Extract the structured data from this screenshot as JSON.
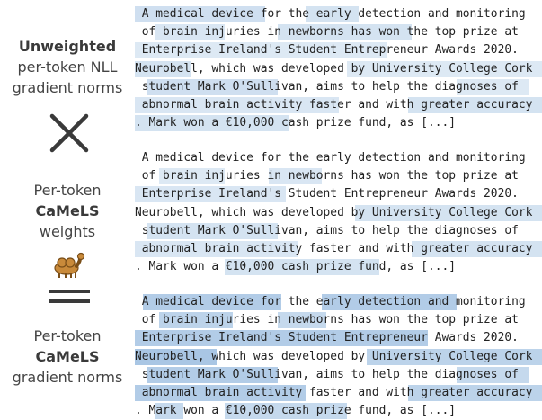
{
  "left_labels": [
    {
      "bold_line": "Unweighted",
      "lines": [
        "per-token NLL",
        "gradient norms"
      ]
    },
    {
      "lines": [
        "Per-token"
      ],
      "bold_line": "CaMeLS",
      "after": [
        "weights"
      ]
    },
    {
      "lines": [
        "Per-token"
      ],
      "bold_line": "CaMeLS",
      "after": [
        "gradient norms"
      ]
    }
  ],
  "operators": [
    "times-icon",
    "equals-icon"
  ],
  "colors": {
    "hl_light": "#dbe8f5",
    "hl_mid": "#b7d0ea",
    "hl_strong": "#8fb1d8",
    "text": "#222222"
  },
  "panels": [
    {
      "id": "unweighted",
      "lines": [
        [
          [
            " A medical device for the early detection and monitoring",
            0
          ]
        ],
        [
          [
            " of brain injuries in newborns has won the top prize at",
            0
          ]
        ],
        [
          [
            " Enterprise Ireland's Student Entrepreneur Awards 2020.",
            0
          ]
        ],
        [
          [
            "Neurobell, which was developed by University College Cork",
            0
          ]
        ],
        [
          [
            " student Mark O'Sullivan, aims to help the diagnoses of",
            0
          ]
        ],
        [
          [
            " abnormal brain activity faster and with greater accuracy",
            0
          ]
        ],
        [
          [
            ". Mark won a €10,000 cash prize fund, as [...]",
            0
          ]
        ]
      ]
    },
    {
      "id": "weights",
      "lines": [
        [
          [
            " A medical device for the early detection and monitoring",
            0
          ]
        ],
        [
          [
            " of brain injuries in newborns has won the top prize at",
            0
          ]
        ],
        [
          [
            " Enterprise Ireland's Student Entrepreneur Awards 2020.",
            0
          ]
        ],
        [
          [
            "Neurobell, which was developed by University College Cork",
            0
          ]
        ],
        [
          [
            " student Mark O'Sullivan, aims to help the diagnoses of",
            0
          ]
        ],
        [
          [
            " abnormal brain activity faster and with greater accuracy",
            0
          ]
        ],
        [
          [
            ". Mark won a €10,000 cash prize fund, as [...]",
            0
          ]
        ]
      ]
    },
    {
      "id": "camels-gradients",
      "lines": [
        [
          [
            " A medical device for the early detection and monitoring",
            0
          ]
        ],
        [
          [
            " of brain injuries in newborns has won the top prize at",
            0
          ]
        ],
        [
          [
            " Enterprise Ireland's Student Entrepreneur Awards 2020.",
            0
          ]
        ],
        [
          [
            "Neurobell, which was developed by University College Cork",
            0
          ]
        ],
        [
          [
            " student Mark O'Sullivan, aims to help the diagnoses of",
            0
          ]
        ],
        [
          [
            " abnormal brain activity faster and with greater accuracy",
            0
          ]
        ],
        [
          [
            ". Mark won a €10,000 cash prize fund, as [...]",
            0
          ]
        ]
      ]
    }
  ]
}
